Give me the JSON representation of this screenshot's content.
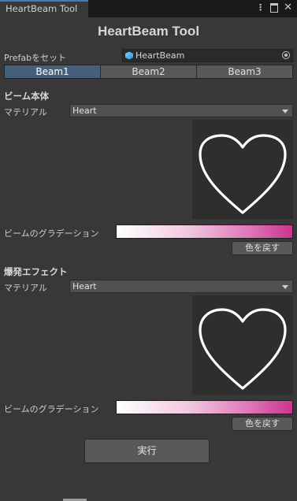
{
  "window": {
    "tab_title": "HeartBeam Tool",
    "menu_icon": "kebab-icon",
    "maximize_icon": "maximize-icon",
    "close_icon": "close-icon"
  },
  "header": {
    "title": "HeartBeam Tool"
  },
  "prefab": {
    "label": "Prefabをセット",
    "value": "HeartBeam"
  },
  "beam_tabs": [
    {
      "label": "Beam1",
      "active": true
    },
    {
      "label": "Beam2"
    },
    {
      "label": "Beam3"
    }
  ],
  "beam_body": {
    "section_title": "ビーム本体",
    "material_label": "マテリアル",
    "material_value": "Heart",
    "gradient_label": "ビームのグラデーション",
    "reset_color_label": "色を戻す"
  },
  "explosion": {
    "section_title": "爆発エフェクト",
    "material_label": "マテリアル",
    "material_value": "Heart",
    "gradient_label": "ビームのグラデーション",
    "reset_color_label": "色を戻す"
  },
  "actions": {
    "run_label": "実行"
  },
  "colors": {
    "active_tab": "#46607c",
    "gradient_start": "#ffffff",
    "gradient_end": "#c8368f"
  }
}
